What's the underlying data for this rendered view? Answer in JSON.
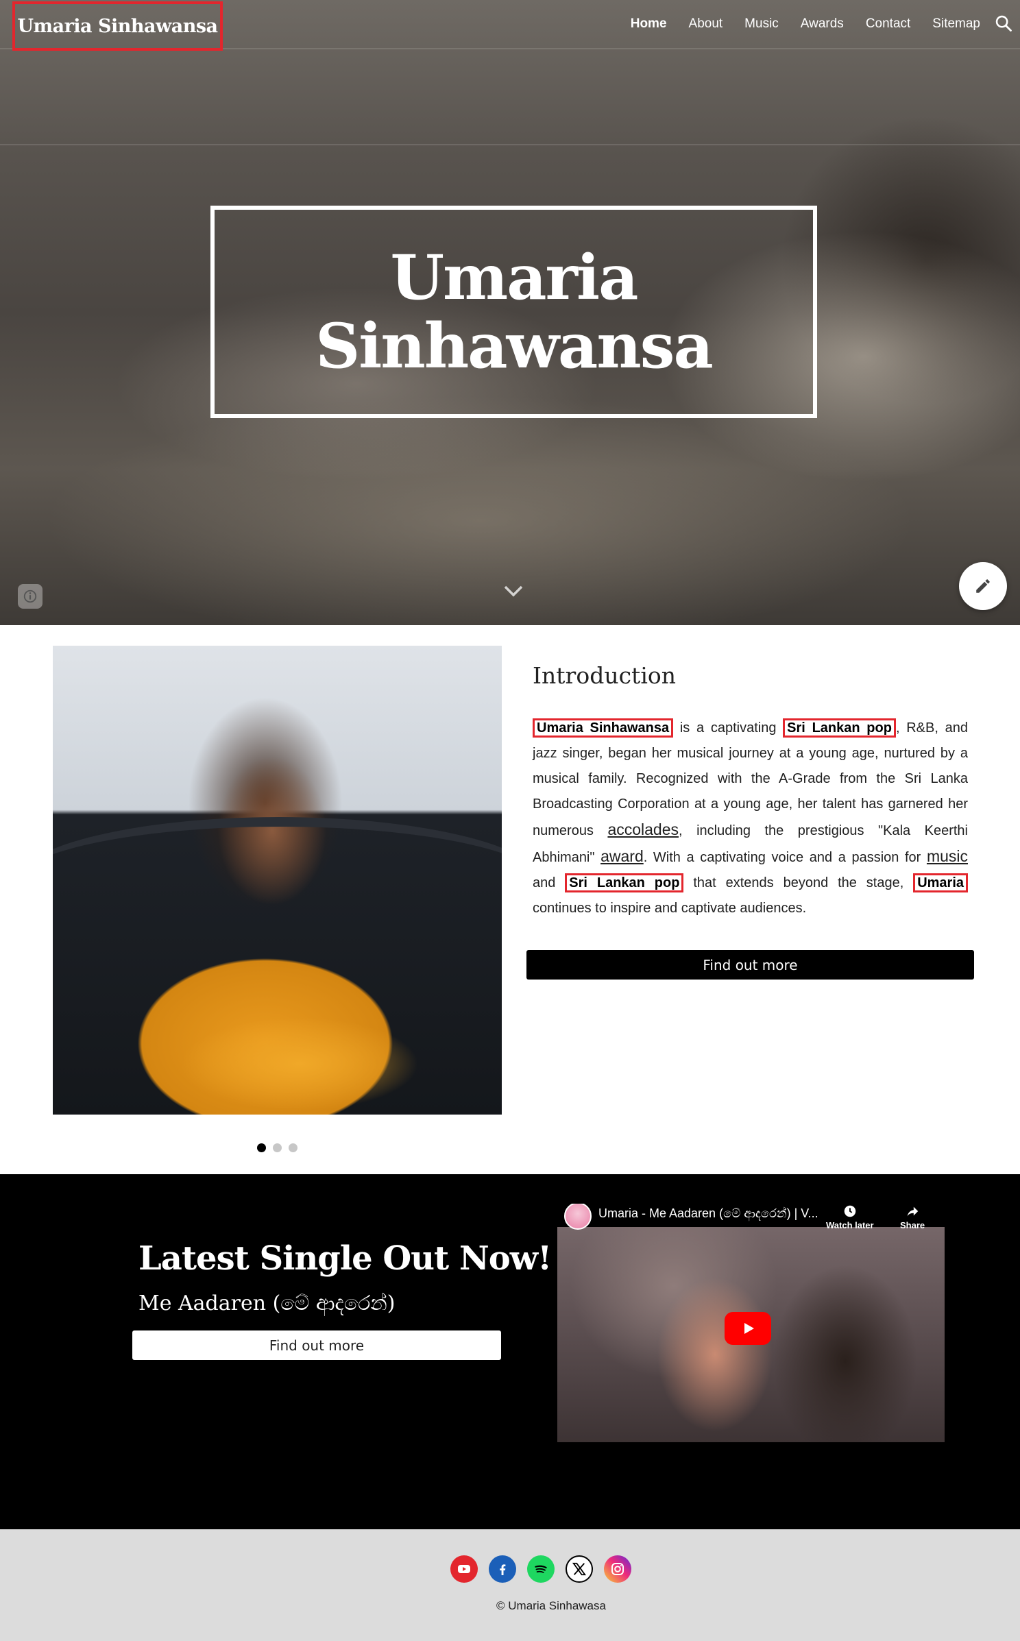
{
  "header": {
    "site_name": "Umaria Sinhawansa",
    "nav": [
      "Home",
      "About",
      "Music",
      "Awards",
      "Contact",
      "Sitemap"
    ]
  },
  "hero": {
    "title_line1": "Umaria",
    "title_line2": "Sinhawansa"
  },
  "intro": {
    "heading": "Introduction",
    "text": {
      "hl1": "Umaria Sinhawansa",
      "t1": " is a captivating ",
      "hl2": "Sri Lankan pop",
      "t2": ", R&B, and jazz singer, began her musical journey at a young age, nurtured by a musical family. Recognized with the A-Grade from the Sri Lanka Broadcasting Corporation at a young age, her talent has garnered her numerous ",
      "link1": "accolades",
      "t3": ", including the prestigious \"Kala Keerthi Abhimani\" ",
      "link2": "award",
      "t4": ". With a captivating voice and a passion for ",
      "link3": "music",
      "t5": " and ",
      "hl3": "Sri Lankan pop",
      "t6": " that extends beyond the stage, ",
      "hl4": "Umaria",
      "t7": " continues to inspire and captivate audiences."
    },
    "button": "Find out more",
    "carousel_dots": 3,
    "carousel_active": 0
  },
  "single": {
    "heading": "Latest Single Out Now!",
    "subheading": "Me Aadaren (මේ ආදරෙන්)",
    "button": "Find out more",
    "video": {
      "title": "Umaria - Me Aadaren (මේ ආදරෙන්) | V...",
      "watch_later": "Watch later",
      "share": "Share"
    }
  },
  "footer": {
    "socials": [
      "youtube-icon",
      "facebook-icon",
      "spotify-icon",
      "x-icon",
      "instagram-icon"
    ],
    "copyright": "© Umaria Sinhawasa"
  },
  "colors": {
    "highlight": "#e3262d",
    "dark": "#000000",
    "footer_bg": "#dcdcdc"
  }
}
